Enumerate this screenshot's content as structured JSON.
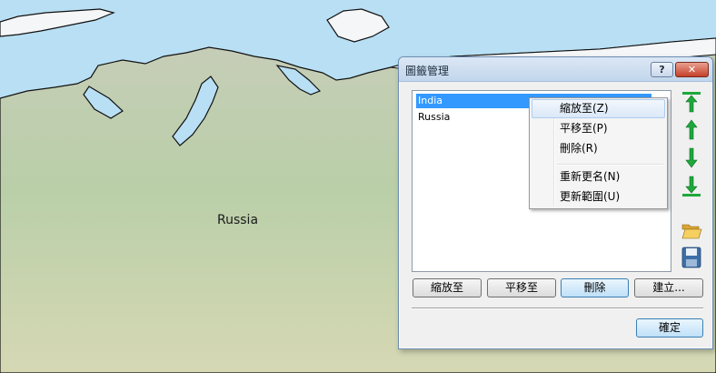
{
  "map": {
    "label": "Russia",
    "colors": {
      "sea": "#b8dff3",
      "land": "#c9d8b8",
      "ice": "#f4f6f8",
      "coast": "#000000"
    }
  },
  "dialog": {
    "title": "圖籤管理",
    "help_label": "?",
    "close_label": "✕",
    "layers": [
      "India",
      "Russia"
    ],
    "selected_index": 0,
    "side_tools": [
      "move-top-icon",
      "move-up-icon",
      "move-down-icon",
      "move-bottom-icon",
      "folder-open-icon",
      "save-icon"
    ],
    "buttons": {
      "zoom": "縮放至",
      "pan": "平移至",
      "delete": "刪除",
      "create": "建立...",
      "ok": "確定"
    }
  },
  "context_menu": {
    "items": {
      "zoom": "縮放至(Z)",
      "pan": "平移至(P)",
      "delete": "刪除(R)",
      "rename": "重新更名(N)",
      "update": "更新範圍(U)"
    }
  },
  "colors": {
    "accent": "#3399ff",
    "arrow_green": "#1ea83c",
    "title_bar": "#c2d6ec"
  }
}
